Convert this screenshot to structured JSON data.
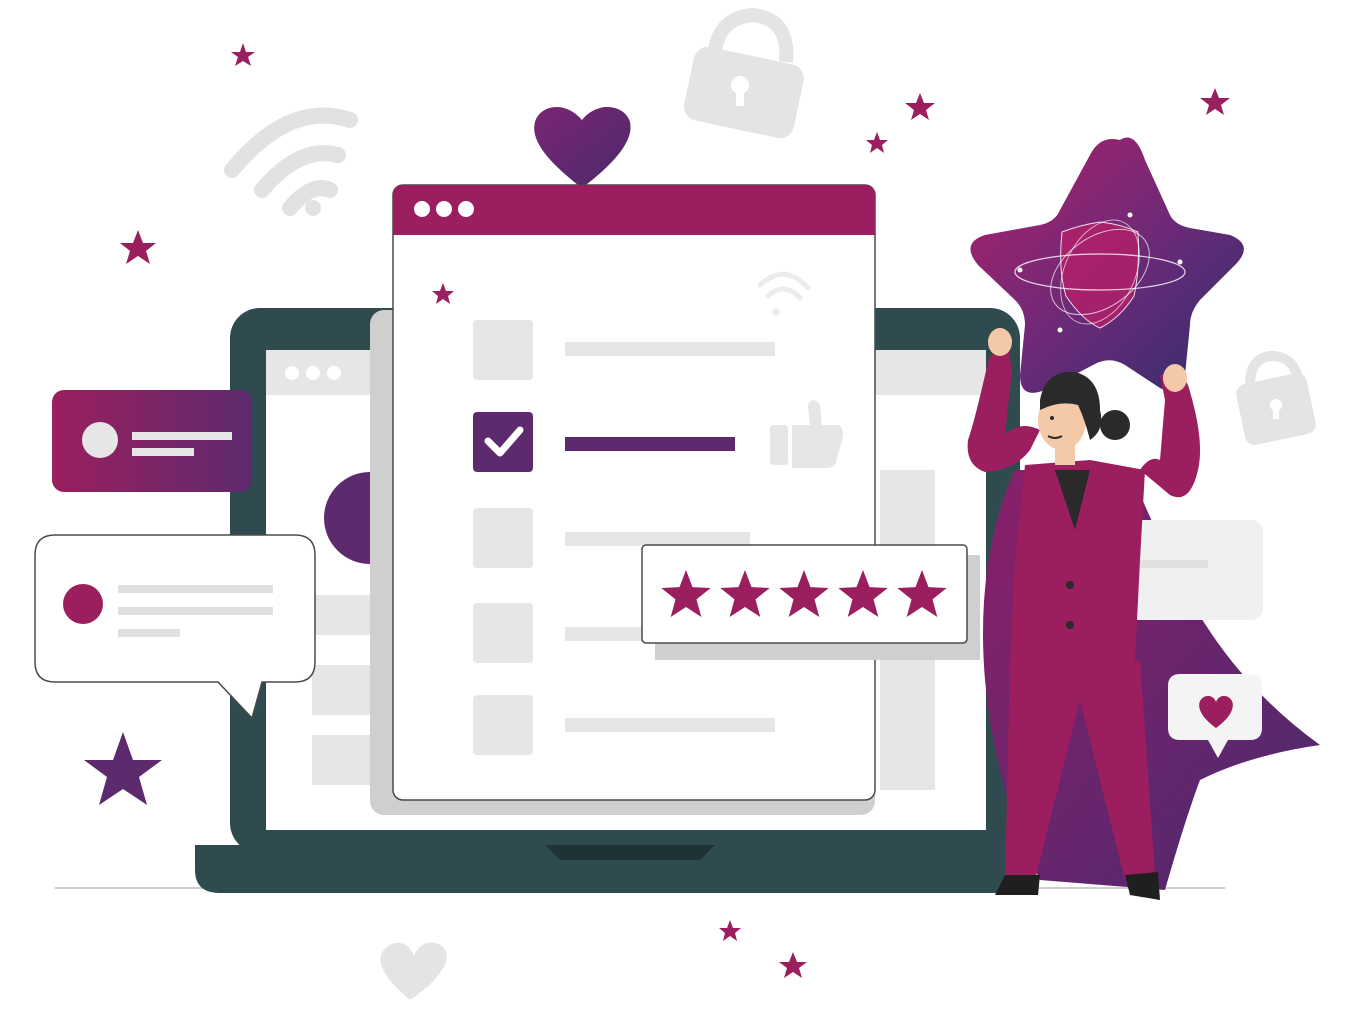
{
  "colors": {
    "primary": "#9b1f5e",
    "deep_purple": "#5d2a6e",
    "navy": "#2d2f6b",
    "laptop": "#2f4b4f",
    "laptop_dark": "#243b3e",
    "light_gray": "#e6e6e6",
    "mid_gray": "#cfcfcf",
    "skin": "#f4c9a8",
    "hair": "#2a2a2a"
  },
  "illustration": {
    "browser_window": {
      "dots_icon": "three-dots-icon",
      "checklist": [
        {
          "checked": false
        },
        {
          "checked": true
        },
        {
          "checked": false
        },
        {
          "checked": false
        },
        {
          "checked": false
        }
      ]
    },
    "rating_card": {
      "stars": 5,
      "max_stars": 5
    },
    "icons": [
      "heart-icon",
      "wifi-icon",
      "lock-icon",
      "thumbs-up-icon",
      "star-icon",
      "shield-icon",
      "chat-bubble-icon"
    ]
  }
}
